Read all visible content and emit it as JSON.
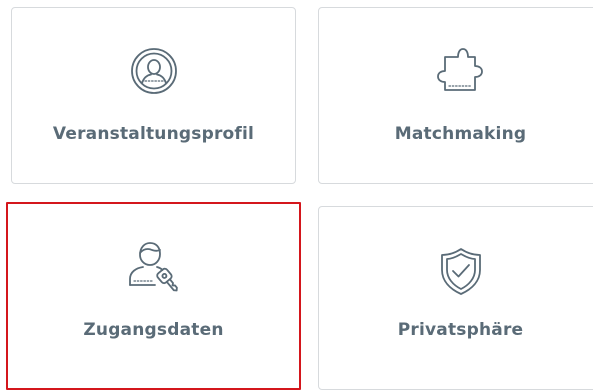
{
  "tiles": [
    {
      "label": "Veranstaltungsprofil",
      "icon": "profile-circle-icon",
      "selected": false
    },
    {
      "label": "Matchmaking",
      "icon": "puzzle-piece-icon",
      "selected": false
    },
    {
      "label": "Zugangsdaten",
      "icon": "user-key-icon",
      "selected": true
    },
    {
      "label": "Privatsphäre",
      "icon": "shield-check-icon",
      "selected": false
    }
  ],
  "colors": {
    "label": "#5a6b77",
    "icon_stroke": "#5a6b77",
    "tile_border": "#d7dadd",
    "selected_border": "#d4161c",
    "background": "#ffffff"
  }
}
